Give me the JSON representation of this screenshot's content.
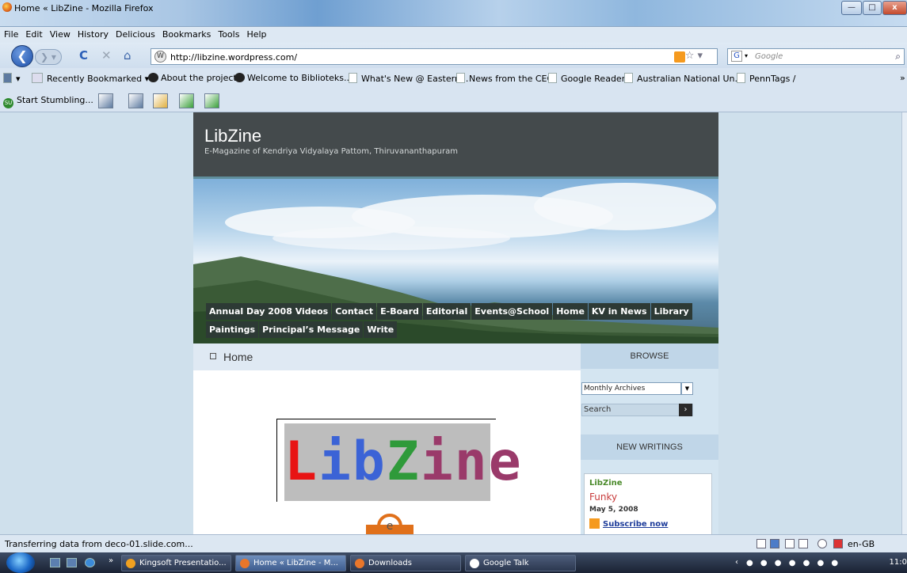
{
  "window": {
    "title": "Home « LibZine - Mozilla Firefox"
  },
  "menu": [
    "File",
    "Edit",
    "View",
    "History",
    "Delicious",
    "Bookmarks",
    "Tools",
    "Help"
  ],
  "nav": {
    "url": "http://libzine.wordpress.com/",
    "search_placeholder": "Google",
    "search_engine": "G"
  },
  "bookmarks": [
    {
      "label": "Recently Bookmarked",
      "icon": "bookmark-icon"
    },
    {
      "label": "About the project",
      "icon": "swap-icon"
    },
    {
      "label": "Welcome to Biblioteks...",
      "icon": "swap-icon"
    },
    {
      "label": "What's New @ Eastern...",
      "icon": "page-icon"
    },
    {
      "label": "News from the CEO",
      "icon": "page-icon"
    },
    {
      "label": "Google Reader",
      "icon": "page-icon"
    },
    {
      "label": "Australian National Un...",
      "icon": "page-icon"
    },
    {
      "label": "PennTags /",
      "icon": "page-icon"
    }
  ],
  "stumble": {
    "label": "Start Stumbling..."
  },
  "site": {
    "title": "LibZine",
    "description": "E-Magazine of Kendriya Vidyalaya Pattom, Thiruvananthapuram",
    "nav": [
      "Annual Day 2008 Videos",
      "Contact",
      "E-Board",
      "Editorial",
      "Events@School",
      "Home",
      "KV in News",
      "Library",
      "Paintings",
      "Principal’s Message",
      "Write"
    ],
    "page_heading": "Home",
    "logo_letters": [
      {
        "ch": "L",
        "color": "#e81414"
      },
      {
        "ch": "i",
        "color": "#3b63d6"
      },
      {
        "ch": "b",
        "color": "#3b63d6"
      },
      {
        "ch": "Z",
        "color": "#2f9a3a"
      },
      {
        "ch": "i",
        "color": "#9a3a6a"
      },
      {
        "ch": "n",
        "color": "#9a3a6a"
      },
      {
        "ch": "e",
        "color": "#9a3a6a"
      }
    ]
  },
  "sidebar": {
    "browse_heading": "BROWSE",
    "archives_value": "Monthly Archives",
    "search_label": "Search",
    "new_writings_heading": "NEW WRITINGS",
    "writing": {
      "title": "LibZine",
      "subtitle": "Funky",
      "date": "May 5, 2008",
      "subscribe": "Subscribe now"
    }
  },
  "status": {
    "text": "Transferring data from deco-01.slide.com...",
    "locale": "en-GB"
  },
  "taskbar": {
    "tasks": [
      {
        "label": "Kingsoft Presentatio...",
        "color": "#f0a020"
      },
      {
        "label": "Home « LibZine - M...",
        "color": "#e9762a"
      },
      {
        "label": "Downloads",
        "color": "#e9762a"
      },
      {
        "label": "Google Talk",
        "color": "#ffffff"
      }
    ],
    "clock": "11:0"
  },
  "colors": {
    "header_bg": "#444a4c",
    "nav_bg": "#2d3a35",
    "sidebar_bg": "#d4e5f1"
  }
}
